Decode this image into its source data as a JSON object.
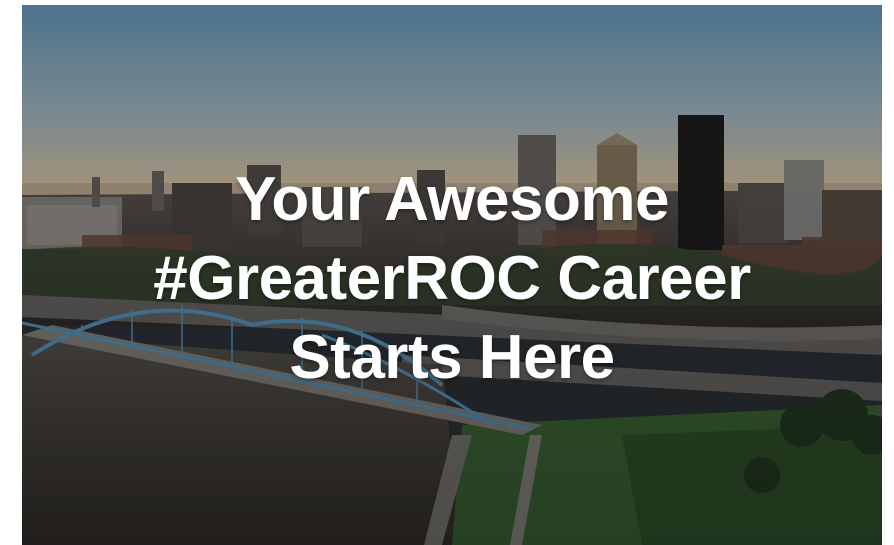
{
  "banner": {
    "headline_lines": [
      "Your Awesome",
      "#GreaterROC Career",
      "Starts Here"
    ],
    "text_color": "#ffffff",
    "scene": {
      "subject": "city-skyline-aerial-photo",
      "sky_top_color": "#5f8fae",
      "sky_bottom_color": "#e9c9a0",
      "river_color": "#4a4640",
      "bridge_color": "#5b9cc7",
      "grass_color": "#3f6a38"
    }
  }
}
